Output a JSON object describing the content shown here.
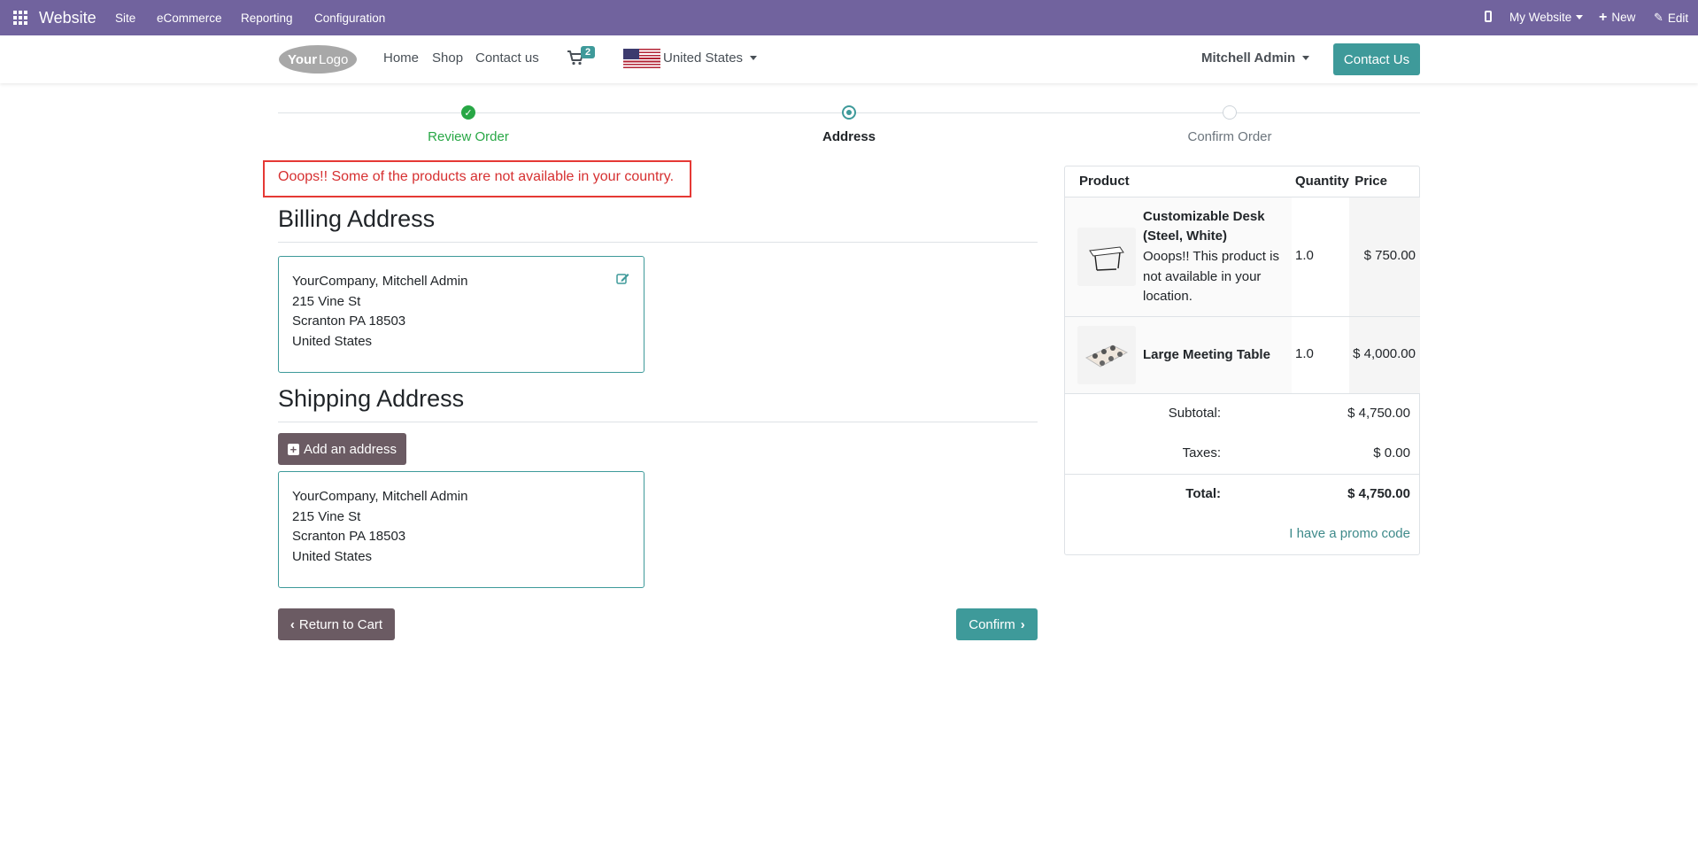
{
  "admin_bar": {
    "brand": "Website",
    "menus": [
      "Site",
      "eCommerce",
      "Reporting",
      "Configuration"
    ],
    "website_selector": "My Website",
    "new_label": "New",
    "edit_label": "Edit"
  },
  "navbar": {
    "links": [
      "Home",
      "Shop",
      "Contact us"
    ],
    "cart_count": "2",
    "country": "United States",
    "user": "Mitchell Admin",
    "contact_button": "Contact Us"
  },
  "steps": [
    {
      "label": "Review Order",
      "state": "done"
    },
    {
      "label": "Address",
      "state": "current"
    },
    {
      "label": "Confirm Order",
      "state": "todo"
    }
  ],
  "alert": "Ooops!! Some of the products are not available in your country.",
  "billing": {
    "title": "Billing Address",
    "lines": [
      "YourCompany, Mitchell Admin",
      "215 Vine St",
      "Scranton PA 18503",
      "United States"
    ]
  },
  "shipping": {
    "title": "Shipping Address",
    "add_button": "Add an address",
    "lines": [
      "YourCompany, Mitchell Admin",
      "215 Vine St",
      "Scranton PA 18503",
      "United States"
    ]
  },
  "buttons": {
    "return": "Return to Cart",
    "confirm": "Confirm"
  },
  "summary": {
    "headers": {
      "product": "Product",
      "quantity": "Quantity",
      "price": "Price"
    },
    "items": [
      {
        "name_line1": "Customizable Desk",
        "name_line2": "(Steel, White)",
        "warning_lines": [
          "Ooops!! This product is",
          "not available in your",
          "location."
        ],
        "quantity": "1.0",
        "price": "$ 750.00"
      },
      {
        "name": "Large Meeting Table",
        "quantity": "1.0",
        "price": "$ 4,000.00"
      }
    ],
    "subtotal_label": "Subtotal:",
    "subtotal": "$ 4,750.00",
    "taxes_label": "Taxes:",
    "taxes": "$ 0.00",
    "total_label": "Total:",
    "total": "$ 4,750.00",
    "promo_link": "I have a promo code"
  },
  "colors": {
    "admin_bar": "#71639e",
    "accent": "#3e9a9a",
    "secondary": "#6b5b63",
    "success": "#28a745",
    "error": "#e53935"
  }
}
